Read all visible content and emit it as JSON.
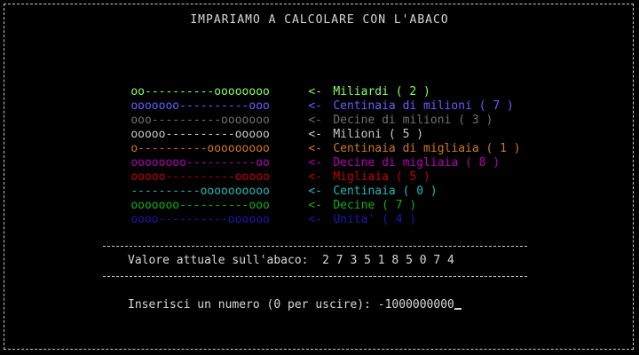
{
  "title": "IMPARIAMO A CALCOLARE CON L'ABACO",
  "rows": [
    {
      "beads": "oo----------oooooooo",
      "arrow": "<-",
      "label": "Miliardi ( 2 )",
      "color": "#88ff66"
    },
    {
      "beads": "ooooooo----------ooo",
      "arrow": "<-",
      "label": "Centinaia di milioni ( 7 )",
      "color": "#6060ff"
    },
    {
      "beads": "ooo----------ooooooo",
      "arrow": "<-",
      "label": "Decine di milioni ( 3 )",
      "color": "#707070"
    },
    {
      "beads": "ooooo----------ooooo",
      "arrow": "<-",
      "label": "Milioni ( 5 )",
      "color": "#c8c8c8"
    },
    {
      "beads": "o----------ooooooooo",
      "arrow": "<-",
      "label": "Centinaia di migliaia ( 1 )",
      "color": "#d07820"
    },
    {
      "beads": "oooooooo----------oo",
      "arrow": "<-",
      "label": "Decine di migliaia ( 8 )",
      "color": "#b000b0"
    },
    {
      "beads": "ooooo----------ooooo",
      "arrow": "<-",
      "label": "Migliaia ( 5 )",
      "color": "#c00000"
    },
    {
      "beads": "----------oooooooooo",
      "arrow": "<-",
      "label": "Centinaia ( 0 )",
      "color": "#20b8b8"
    },
    {
      "beads": "ooooooo----------ooo",
      "arrow": "<-",
      "label": "Decine ( 7 )",
      "color": "#10b010"
    },
    {
      "beads": "oooo----------oooooo",
      "arrow": "<-",
      "label": "Unita' ( 4 )",
      "color": "#1818b0"
    }
  ],
  "value": {
    "label": "Valore attuale sull'abaco:",
    "digits": "2 7 3 5 1 8 5 0 7 4"
  },
  "prompt": {
    "label": "Inserisci un numero (0 per uscire):",
    "input": "-1000000000"
  },
  "separator": "-----------------------------------------------------------"
}
